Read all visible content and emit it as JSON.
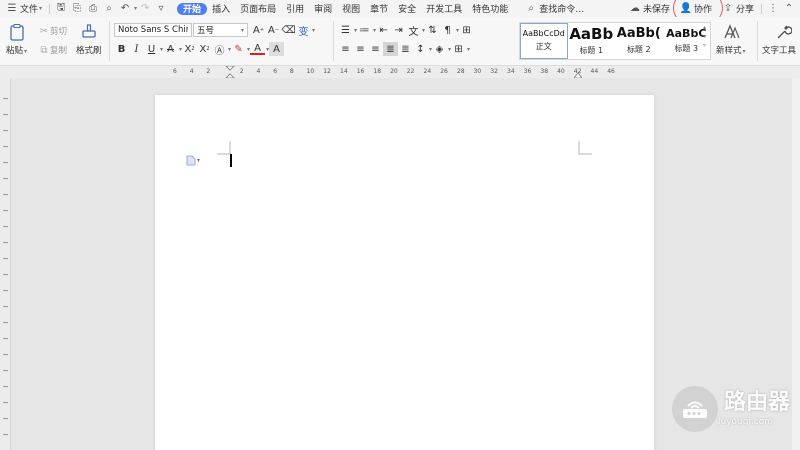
{
  "menubar": {
    "file_label": "文件",
    "tabs": [
      "开始",
      "插入",
      "页面布局",
      "引用",
      "审阅",
      "视图",
      "章节",
      "安全",
      "开发工具",
      "特色功能"
    ],
    "search_label": "查找命令…",
    "unsaved_label": "未保存",
    "collab_label": "协作",
    "share_label": "分享"
  },
  "ribbon": {
    "paste_label": "粘贴",
    "cut_label": "剪切",
    "copy_label": "复制",
    "format_painter_label": "格式刷",
    "font_name": "Noto Sans S Chir",
    "font_size": "五号",
    "styles": [
      {
        "preview": "AaBbCcDd",
        "name": "正文"
      },
      {
        "preview": "AaBb",
        "name": "标题 1"
      },
      {
        "preview": "AaBb(",
        "name": "标题 2"
      },
      {
        "preview": "AaBbC",
        "name": "标题 3"
      }
    ],
    "new_style_label": "新样式",
    "text_tools_label": "文字工具"
  },
  "ruler": {
    "ticks": [
      "6",
      "4",
      "2",
      "",
      "2",
      "4",
      "6",
      "8",
      "10",
      "12",
      "14",
      "16",
      "18",
      "20",
      "22",
      "24",
      "26",
      "28",
      "30",
      "32",
      "34",
      "36",
      "38",
      "40",
      "42",
      "44",
      "46"
    ]
  },
  "watermark": {
    "title": "路由器",
    "subtitle": "luyouqi.com"
  },
  "colors": {
    "accent": "#4e7ef3",
    "highlight_circle": "#e55a5a",
    "font_color_red": "#e02020",
    "font_color_blue": "#2036e0"
  }
}
